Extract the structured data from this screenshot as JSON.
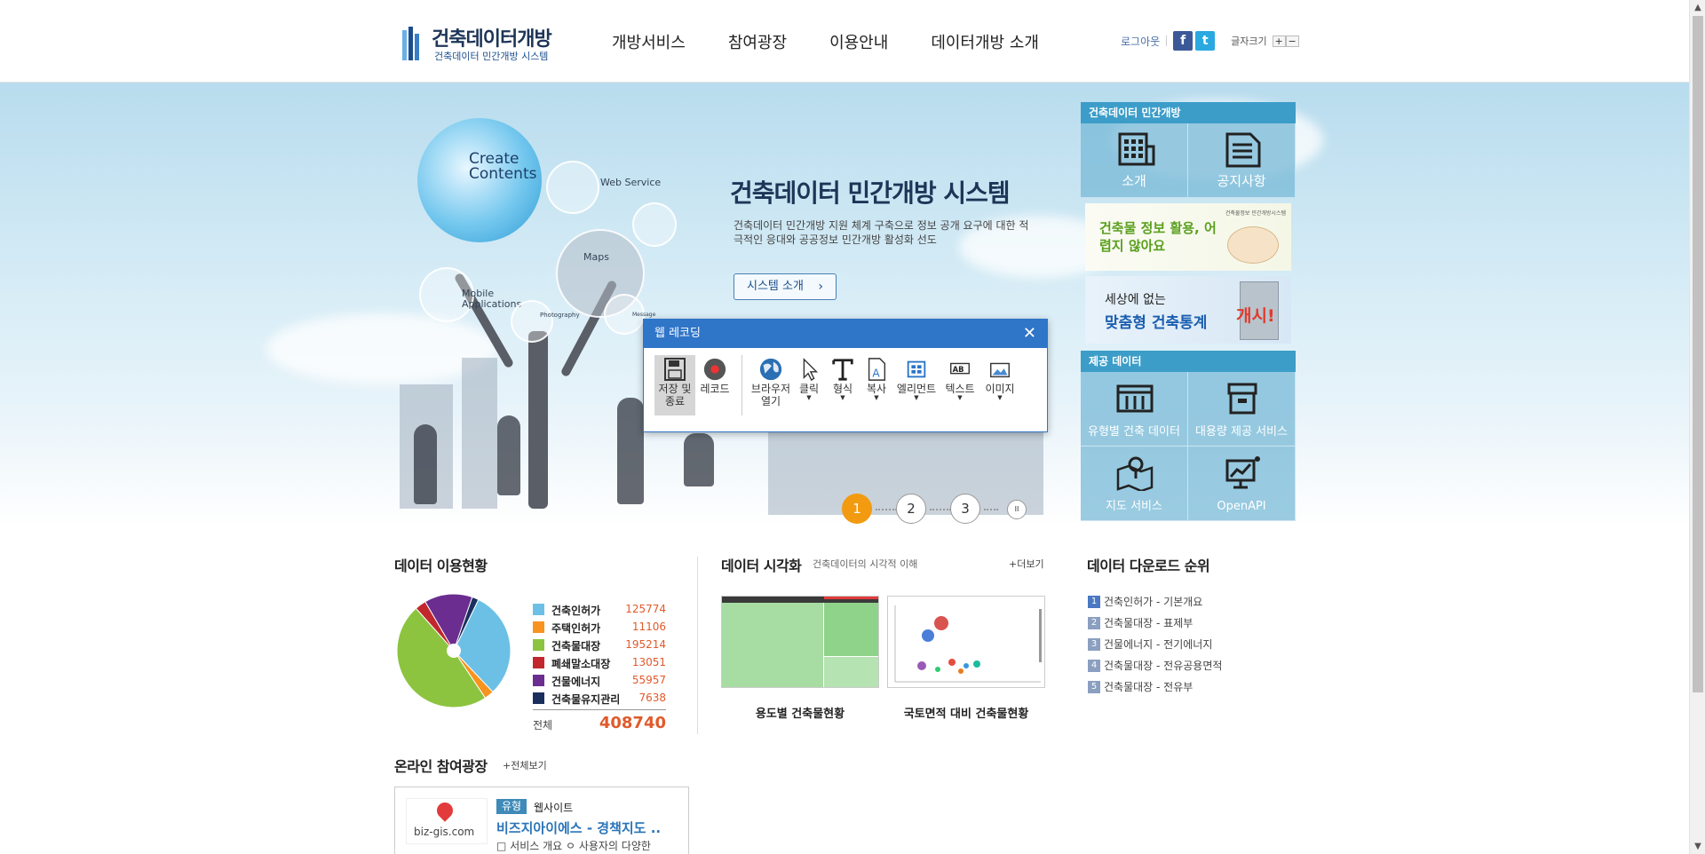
{
  "header": {
    "logo_title": "건축데이터개방",
    "logo_sub": "건축데이터 민간개방 시스템",
    "nav": [
      "개방서비스",
      "참여광장",
      "이용안내",
      "데이터개방 소개"
    ],
    "logout": "로그아웃",
    "facebook": "f",
    "twitter": "t",
    "font_size_label": "글자크기",
    "font_plus": "+",
    "font_minus": "−"
  },
  "visual": {
    "bubble_text": "Create Contents",
    "labels": {
      "web_service": "Web Service",
      "maps": "Maps",
      "mobile": "Mobile Applications",
      "photography": "Photography",
      "message": "Message"
    },
    "title": "건축데이터 민간개방 시스템",
    "desc": "건축데이터 민간개방 지원 체계 구축으로 정보 공개 요구에 대한 적극적인 응대와 공공정보 민간개방 활성화 선도",
    "button": "시스템 소개",
    "pager": [
      "1",
      "2",
      "3"
    ],
    "pause": "II"
  },
  "quick": {
    "head1": "건축데이터 민간개방",
    "intro": "소개",
    "notice": "공지사항",
    "banner1": "건축물 정보 활용, 어렵지 않아요",
    "banner1_small": "건축물정보 민간개방시스템",
    "banner2_a": "세상에 없는",
    "banner2_b": "맞춤형 건축통계",
    "banner2_c": "개시!",
    "head2": "제공 데이터",
    "cells": [
      "유형별 건축 데이터",
      "대용량 제공 서비스",
      "지도 서비스",
      "OpenAPI"
    ]
  },
  "recorder": {
    "title": "웹 레코딩",
    "close": "✕",
    "tools": [
      {
        "label": "저장 및 종료",
        "name": "save"
      },
      {
        "label": "레코드",
        "name": "record"
      },
      {
        "label": "브라우저 열기",
        "name": "browser"
      },
      {
        "label": "클릭",
        "name": "click"
      },
      {
        "label": "형식",
        "name": "type"
      },
      {
        "label": "복사",
        "name": "copy"
      },
      {
        "label": "엘리먼트",
        "name": "element"
      },
      {
        "label": "텍스트",
        "name": "text"
      },
      {
        "label": "이미지",
        "name": "image"
      }
    ],
    "save_line1": "저장 및",
    "save_line2": "종료",
    "browser_line1": "브라우저",
    "browser_line2": "열기"
  },
  "usage": {
    "title": "데이터 이용현황",
    "total_label": "전체",
    "total_value": "408740"
  },
  "chart_data": {
    "type": "pie",
    "title": "데이터 이용현황",
    "categories": [
      "건축인허가",
      "주택인허가",
      "건축물대장",
      "폐쇄말소대장",
      "건물에너지",
      "건축물유지관리"
    ],
    "values": [
      125774,
      11106,
      195214,
      13051,
      55957,
      7638
    ],
    "colors": [
      "#6cc0e5",
      "#f7931e",
      "#8cc43f",
      "#c1272d",
      "#6b2e90",
      "#1a2f5e"
    ],
    "total": 408740
  },
  "viz": {
    "title": "데이터 시각화",
    "sub": "건축데이터의 시각적 이해",
    "more": "+더보기",
    "items": [
      "용도별 건축물현황",
      "국토면적 대비 건축물현황"
    ]
  },
  "download": {
    "title": "데이터 다운로드 순위",
    "items": [
      "건축인허가 - 기본개요",
      "건축물대장 - 표제부",
      "건물에너지 - 전기에너지",
      "건축물대장 - 전유공용면적",
      "건축물대장 - 전유부"
    ]
  },
  "online": {
    "title": "온라인 참여광장",
    "more": "+전체보기",
    "type_label": "유형",
    "type_value": "웹사이트",
    "item_title": "비즈지아이에스 - 경책지도 ..",
    "item_desc": "□ 서비스 개요 ㅇ 사용자의 다양한",
    "logo_text": "biz-gis.com"
  }
}
